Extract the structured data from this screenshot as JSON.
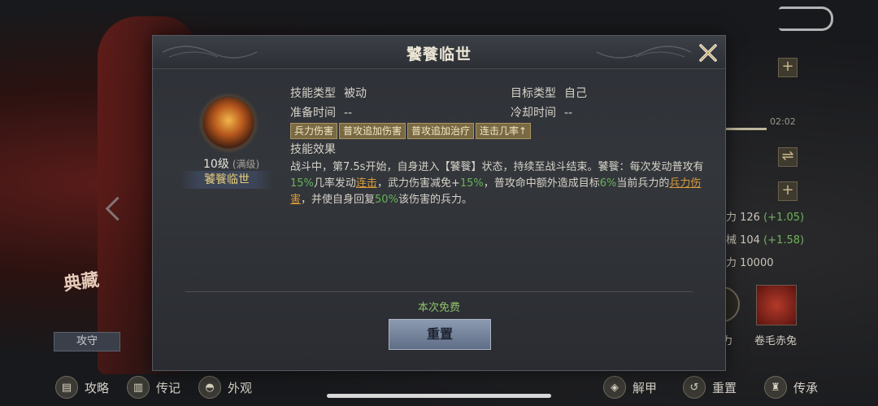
{
  "dialog": {
    "title": "饕餮临世",
    "skill": {
      "level": "10级",
      "max_label": "(满级)",
      "name": "饕餮临世"
    },
    "info": {
      "skill_type_label": "技能类型",
      "skill_type_value": "被动",
      "target_type_label": "目标类型",
      "target_type_value": "自己",
      "prep_time_label": "准备时间",
      "prep_time_value": "--",
      "cooldown_label": "冷却时间",
      "cooldown_value": "--"
    },
    "tags": [
      "兵力伤害",
      "普攻追加伤害",
      "普攻追加治疗",
      "连击几率↑"
    ],
    "effect_title": "技能效果",
    "effect": {
      "p1": "战斗中，第7.5s开始，自身进入【饕餮】状态，持续至战斗结束。饕餮：每次发动普攻有",
      "v1": "15%",
      "p2": "几率发动",
      "link1": "连击",
      "p3": "，武力伤害减免+",
      "v2": "15%",
      "p4": "，普攻命中额外造成目标",
      "v3": "6%",
      "p5": "当前兵力的",
      "link2": "兵力伤害",
      "p6": "，并使自身回复",
      "v4": "50%",
      "p7": "该伤害的兵力。"
    },
    "free_note": "本次免费",
    "reset_label": "重置"
  },
  "background": {
    "progress_time": "02:02",
    "stats": [
      {
        "label": "力 126",
        "plus": "(+1.05)"
      },
      {
        "label": "械 104",
        "plus": "(+1.58)"
      },
      {
        "label": "力 10000",
        "plus": ""
      }
    ],
    "mount_label": "卷毛赤兔",
    "partial_label": "力",
    "seal_text": "典藏",
    "tab_label": "攻守",
    "bottom_left": [
      "攻略",
      "传记",
      "外观"
    ],
    "bottom_right": [
      "解甲",
      "重置",
      "传承"
    ]
  },
  "colors": {
    "accent_green": "#67b45a",
    "link_orange": "#d99a3a",
    "gold_name": "#e8cf7a"
  }
}
